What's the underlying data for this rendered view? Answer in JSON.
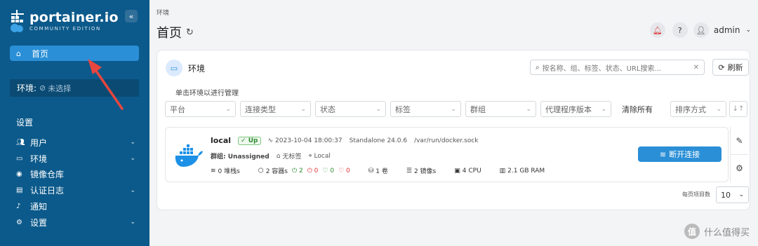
{
  "brand": {
    "name": "portainer.io",
    "edition": "COMMUNITY EDITION"
  },
  "sidebar": {
    "collapse_glyph": "«",
    "home_label": "首页",
    "env_label": "环境:",
    "env_value": "未选择",
    "section_title": "设置",
    "items": [
      {
        "label": "用户",
        "has_chevron": true
      },
      {
        "label": "环境",
        "has_chevron": true
      },
      {
        "label": "镜像仓库",
        "has_chevron": false
      },
      {
        "label": "认证日志",
        "has_chevron": true
      },
      {
        "label": "通知",
        "has_chevron": false
      },
      {
        "label": "设置",
        "has_chevron": true
      }
    ]
  },
  "header": {
    "breadcrumb": "环境",
    "title": "首页",
    "user": "admin"
  },
  "card": {
    "title": "环境",
    "search_placeholder": "按名称、组、标签、状态、URL搜索...",
    "refresh_label": "刷新",
    "hint": "单击环境以进行管理",
    "filters": [
      "平台",
      "连接类型",
      "状态",
      "标签",
      "群组",
      "代理程序版本"
    ],
    "clear_all": "清除所有",
    "sort_label": "排序方式"
  },
  "environment": {
    "name": "local",
    "status": "Up",
    "timestamp": "2023-10-04 18:00:37",
    "type": "Standalone 24.0.6",
    "socket": "/var/run/docker.sock",
    "group": "群组: Unassigned",
    "tags": "无标签",
    "locality": "Local",
    "stacks": "0 堆栈s",
    "containers": "2 容器s",
    "running": "2",
    "stopped": "0",
    "healthy": "0",
    "unhealthy": "0",
    "volumes": "1 卷",
    "images": "2 镜像s",
    "cpu": "4 CPU",
    "ram": "2.1 GB RAM",
    "disconnect_label": "断开连接"
  },
  "pagination": {
    "label": "每页项目数",
    "value": "10"
  },
  "watermark": {
    "text": "什么值得买",
    "glyph": "值"
  },
  "colors": {
    "sidebar": "#0c5a8b",
    "accent": "#2a8fd6",
    "annotation_arrow": "#e8463e"
  }
}
